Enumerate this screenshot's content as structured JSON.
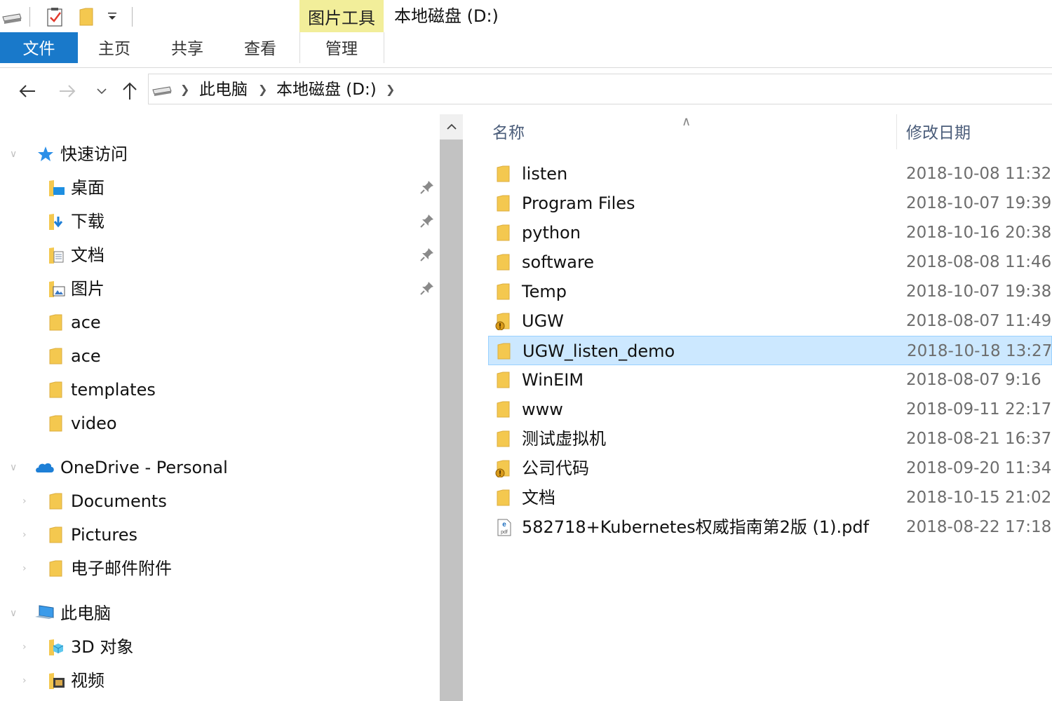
{
  "window": {
    "context_tab_group": "图片工具",
    "title": "本地磁盘 (D:)"
  },
  "ribbon": {
    "tabs": [
      "文件",
      "主页",
      "共享",
      "查看",
      "管理"
    ]
  },
  "address": {
    "crumbs": [
      "此电脑",
      "本地磁盘 (D:)"
    ]
  },
  "nav": {
    "quick_access": "快速访问",
    "quick_items": [
      {
        "label": "桌面",
        "icon": "desktop-folder-icon",
        "pinned": true
      },
      {
        "label": "下载",
        "icon": "downloads-folder-icon",
        "pinned": true
      },
      {
        "label": "文档",
        "icon": "documents-folder-icon",
        "pinned": true
      },
      {
        "label": "图片",
        "icon": "pictures-folder-icon",
        "pinned": true
      },
      {
        "label": "ace",
        "icon": "folder-icon",
        "pinned": false
      },
      {
        "label": "ace",
        "icon": "folder-icon",
        "pinned": false
      },
      {
        "label": "templates",
        "icon": "folder-icon",
        "pinned": false
      },
      {
        "label": "video",
        "icon": "folder-icon",
        "pinned": false
      }
    ],
    "onedrive": "OneDrive - Personal",
    "onedrive_items": [
      "Documents",
      "Pictures",
      "电子邮件附件"
    ],
    "this_pc": "此电脑",
    "pc_items": [
      {
        "label": "3D 对象",
        "icon": "3d-objects-folder-icon"
      },
      {
        "label": "视频",
        "icon": "videos-folder-icon"
      }
    ]
  },
  "filelist": {
    "columns": {
      "name": "名称",
      "modified": "修改日期"
    },
    "rows": [
      {
        "name": "listen",
        "date": "2018-10-08 11:32",
        "type": "folder"
      },
      {
        "name": "Program Files",
        "date": "2018-10-07 19:39",
        "type": "folder"
      },
      {
        "name": "python",
        "date": "2018-10-16 20:38",
        "type": "folder"
      },
      {
        "name": "software",
        "date": "2018-08-08 11:46",
        "type": "folder"
      },
      {
        "name": "Temp",
        "date": "2018-10-07 19:38",
        "type": "folder"
      },
      {
        "name": "UGW",
        "date": "2018-08-07 11:49",
        "type": "folder-warning"
      },
      {
        "name": "UGW_listen_demo",
        "date": "2018-10-18 13:27",
        "type": "folder",
        "selected": true
      },
      {
        "name": "WinEIM",
        "date": "2018-08-07 9:16",
        "type": "folder"
      },
      {
        "name": "www",
        "date": "2018-09-11 22:17",
        "type": "folder"
      },
      {
        "name": "测试虚拟机",
        "date": "2018-08-21 16:37",
        "type": "folder"
      },
      {
        "name": "公司代码",
        "date": "2018-09-20 11:34",
        "type": "folder-warning"
      },
      {
        "name": "文档",
        "date": "2018-10-15 21:02",
        "type": "folder"
      },
      {
        "name": "582718+Kubernetes权威指南第2版 (1).pdf",
        "date": "2018-08-22 17:18",
        "type": "pdf"
      }
    ]
  },
  "colors": {
    "accent": "#1979ca",
    "context_tab": "#f2ee9a",
    "selection": "#cce8ff",
    "folder": "#f4c84f"
  }
}
